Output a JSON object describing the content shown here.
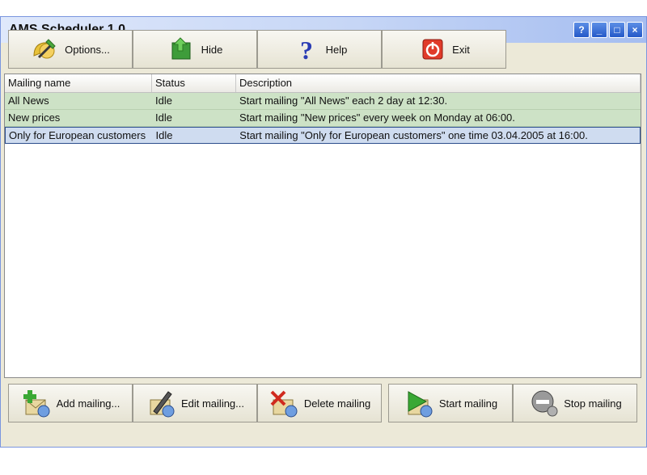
{
  "window": {
    "title": "AMS Scheduler 1.0"
  },
  "titlebar_buttons": {
    "help": "?",
    "minimize": "_",
    "maximize": "□",
    "close": "×"
  },
  "toolbar": {
    "options": {
      "label": "Options...",
      "icon": "options-icon"
    },
    "hide": {
      "label": "Hide",
      "icon": "hide-icon"
    },
    "help": {
      "label": "Help",
      "icon": "help-icon"
    },
    "exit": {
      "label": "Exit",
      "icon": "exit-icon"
    }
  },
  "list": {
    "columns": [
      "Mailing name",
      "Status",
      "Description"
    ],
    "rows": [
      {
        "name": "All News",
        "status": "Idle",
        "description": "Start mailing \"All News\" each 2 day at 12:30."
      },
      {
        "name": "New prices",
        "status": "Idle",
        "description": "Start mailing \"New prices\" every week on Monday at 06:00."
      },
      {
        "name": "Only for European customers",
        "status": "Idle",
        "description": "Start mailing \"Only for European customers\" one time 03.04.2005 at 16:00."
      }
    ]
  },
  "bottom": {
    "add": {
      "label": "Add mailing..."
    },
    "edit": {
      "label": "Edit mailing..."
    },
    "delete": {
      "label": "Delete mailing"
    },
    "start": {
      "label": "Start mailing"
    },
    "stop": {
      "label": "Stop mailing"
    }
  },
  "colors": {
    "row_green": "#cde2c6",
    "row_selected": "#cfdcf0",
    "title_gradient": "#a5bdf0"
  }
}
